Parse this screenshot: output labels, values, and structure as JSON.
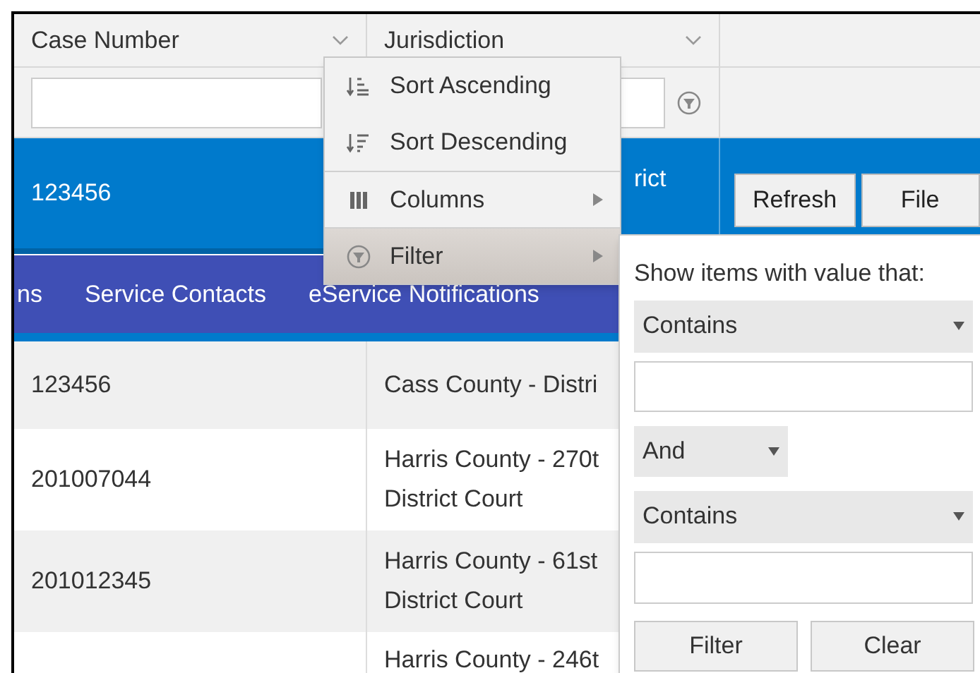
{
  "table": {
    "columns": [
      {
        "label": "Case Number"
      },
      {
        "label": "Jurisdiction"
      }
    ],
    "selected_row": {
      "case_number": "123456",
      "jurisdiction": "rict",
      "buttons": [
        "Refresh",
        "File"
      ]
    },
    "tabs": [
      {
        "label": "ns"
      },
      {
        "label": "Service Contacts"
      },
      {
        "label": "eService Notifications"
      }
    ],
    "rows": [
      {
        "case_number": "123456",
        "jurisdiction": [
          "Cass County - Distri"
        ]
      },
      {
        "case_number": "201007044",
        "jurisdiction": [
          "Harris County - 270t",
          "District Court"
        ]
      },
      {
        "case_number": "201012345",
        "jurisdiction": [
          "Harris County - 61st",
          "District Court"
        ]
      },
      {
        "jurisdiction": [
          "Harris County - 246t"
        ]
      }
    ]
  },
  "column_menu": {
    "items": [
      {
        "kind": "sort-asc",
        "label": "Sort Ascending",
        "submenu": false,
        "selected": false
      },
      {
        "kind": "sort-desc",
        "label": "Sort Descending",
        "submenu": false,
        "selected": false
      },
      {
        "kind": "columns",
        "label": "Columns",
        "submenu": true,
        "selected": false
      },
      {
        "kind": "filter",
        "label": "Filter",
        "submenu": true,
        "selected": true
      }
    ]
  },
  "filter_popup": {
    "prompt": "Show items with value that:",
    "operator_1": "Contains",
    "logic": "And",
    "operator_2": "Contains",
    "buttons": [
      "Filter",
      "Clear"
    ]
  }
}
